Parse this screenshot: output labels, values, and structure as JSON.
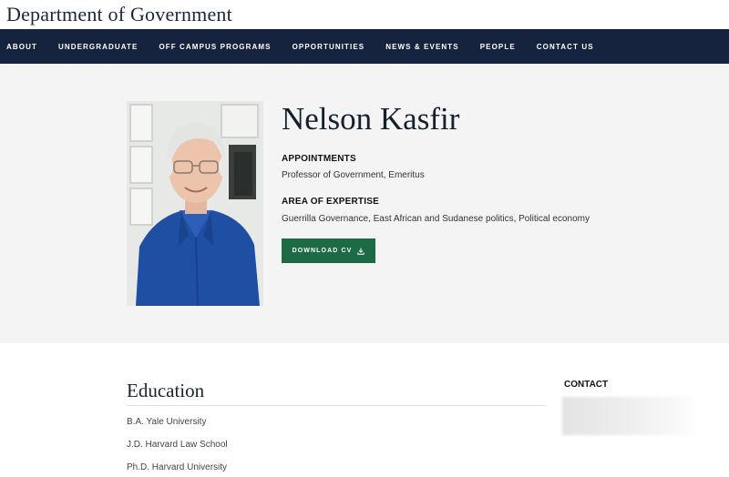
{
  "header": {
    "site_title": "Department of Government"
  },
  "nav": {
    "items": [
      {
        "label": "ABOUT"
      },
      {
        "label": "UNDERGRADUATE"
      },
      {
        "label": "OFF CAMPUS PROGRAMS"
      },
      {
        "label": "OPPORTUNITIES"
      },
      {
        "label": "NEWS & EVENTS"
      },
      {
        "label": "PEOPLE"
      },
      {
        "label": "CONTACT US"
      }
    ]
  },
  "profile": {
    "name": "Nelson Kasfir",
    "appointments_label": "APPOINTMENTS",
    "appointments_value": "Professor of Government, Emeritus",
    "expertise_label": "AREA OF EXPERTISE",
    "expertise_value": "Guerrilla Governance, East African and Sudanese politics, Political economy",
    "cv_button_label": "DOWNLOAD CV",
    "cv_button_icon": "download-icon"
  },
  "education": {
    "heading": "Education",
    "items": [
      {
        "text": "B.A. Yale University"
      },
      {
        "text": "J.D. Harvard Law School"
      },
      {
        "text": "Ph.D. Harvard University"
      }
    ]
  },
  "contact": {
    "heading": "CONTACT"
  },
  "colors": {
    "nav_bg": "#16233f",
    "hero_bg": "#f4f4f4",
    "button_bg": "#1d6b45",
    "title_text": "#1a2540"
  }
}
